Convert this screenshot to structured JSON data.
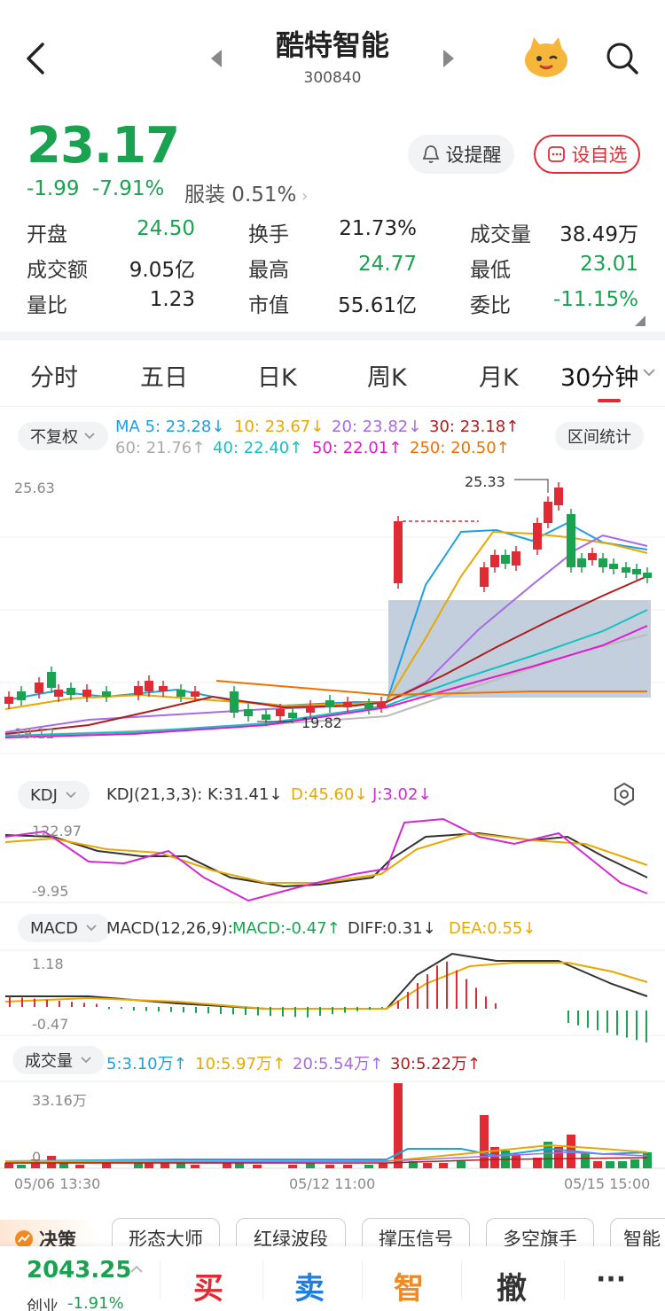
{
  "header": {
    "name": "酷特智能",
    "code": "300840"
  },
  "quote": {
    "price": "23.17",
    "change": "-1.99",
    "change_pct": "-7.91%",
    "sector": "服装 0.51%",
    "remind_label": "设提醒",
    "watch_label": "设自选"
  },
  "stats": [
    {
      "label": "开盘",
      "value": "24.50",
      "color": "green"
    },
    {
      "label": "换手",
      "value": "21.73%",
      "color": "dark"
    },
    {
      "label": "成交量",
      "value": "38.49万",
      "color": "dark"
    },
    {
      "label": "成交额",
      "value": "9.05亿",
      "color": "dark"
    },
    {
      "label": "最高",
      "value": "24.77",
      "color": "green"
    },
    {
      "label": "最低",
      "value": "23.01",
      "color": "green"
    },
    {
      "label": "量比",
      "value": "1.23",
      "color": "dark"
    },
    {
      "label": "市值",
      "value": "55.61亿",
      "color": "dark"
    },
    {
      "label": "委比",
      "value": "-11.15%",
      "color": "green"
    }
  ],
  "tabs": [
    "分时",
    "五日",
    "日K",
    "周K",
    "月K",
    "30分钟"
  ],
  "active_tab": 5,
  "ma": {
    "adjust": "不复权",
    "stats_button": "区间统计",
    "row1": [
      {
        "text": "MA 5: 23.28↓",
        "color": "#1ea0e0"
      },
      {
        "text": "10: 23.67↓",
        "color": "#e9a800"
      },
      {
        "text": "20: 23.82↓",
        "color": "#a66be6"
      },
      {
        "text": "30: 23.18↑",
        "color": "#b01d1d"
      }
    ],
    "row2": [
      {
        "text": "60: 21.76↑",
        "color": "#aaaaaa"
      },
      {
        "text": "40: 22.40↑",
        "color": "#12c2c2"
      },
      {
        "text": "50: 22.01↑",
        "color": "#e01ad0"
      },
      {
        "text": "250: 20.50↑",
        "color": "#f07000"
      }
    ]
  },
  "kline": {
    "max_label": "25.63",
    "min_label": "19.12",
    "high_mark": "25.33",
    "low_mark": "19.82"
  },
  "kdj": {
    "name": "KDJ",
    "params": "KDJ(21,3,3):",
    "k": "K:31.41↓",
    "d": "D:45.60↓",
    "j": "J:3.02↓",
    "top": "122.97",
    "bottom": "-9.95"
  },
  "macd": {
    "name": "MACD",
    "params": "MACD(12,26,9):",
    "macd": "MACD:-0.47↑",
    "diff": "DIFF:0.31↓",
    "dea": "DEA:0.55↓",
    "top": "1.18",
    "bottom": "-0.47"
  },
  "volume": {
    "name": "成交量",
    "m5": "5:3.10万↑",
    "m10": "10:5.97万↑",
    "m20": "20:5.54万↑",
    "m30": "30:5.22万↑",
    "top": "33.16万",
    "zero": "0"
  },
  "dates": [
    "05/06 13:30",
    "05/12 11:00",
    "05/15 15:00"
  ],
  "strategies": {
    "badge": "决策",
    "items": [
      "形态大师",
      "红绿波段",
      "撑压信号",
      "多空旗手",
      "智能"
    ]
  },
  "bottom": {
    "index_value": "2043.25",
    "index_name": "创业",
    "index_pct": "-1.91%",
    "buy": "买",
    "sell": "卖",
    "smart": "智",
    "cancel": "撤",
    "more": "···"
  },
  "colors": {
    "up": "#e02b35",
    "down": "#1aa251",
    "accent": "#e02b35"
  }
}
